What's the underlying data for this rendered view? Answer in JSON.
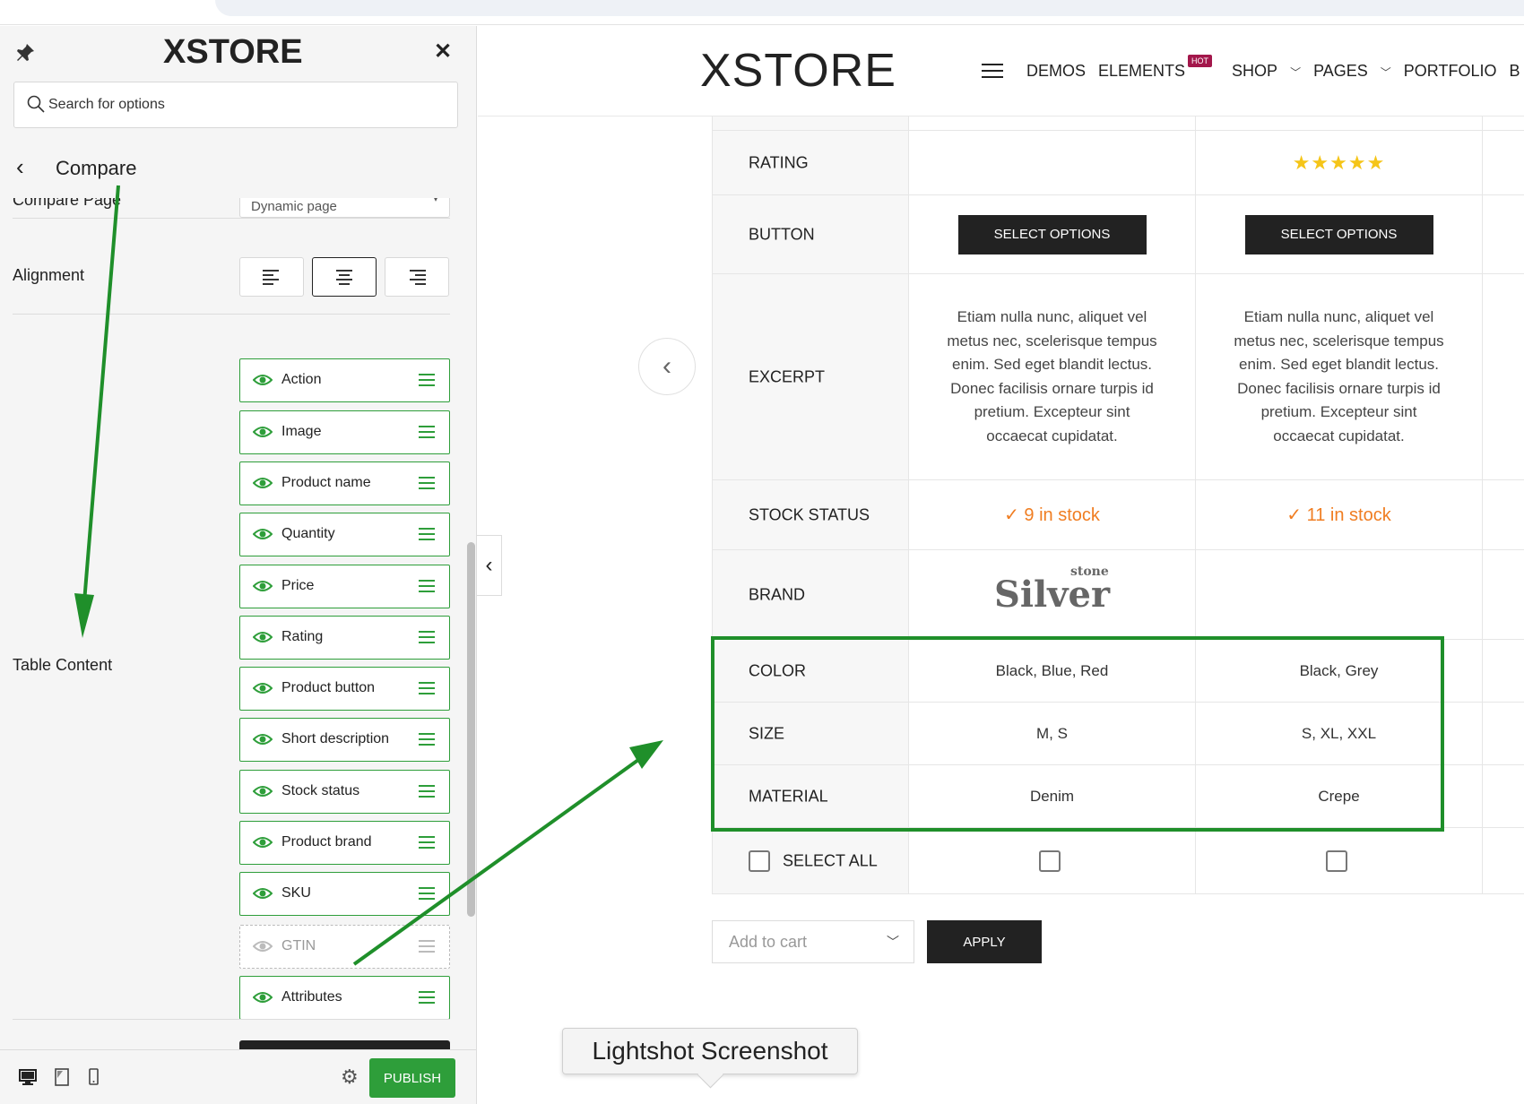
{
  "customizer": {
    "logo": "XSTORE",
    "search_placeholder": "Search for options",
    "section_title": "Compare",
    "compare_page_label": "Compare Page",
    "compare_page_value": "Dynamic page",
    "alignment_label": "Alignment",
    "table_content_label": "Table Content",
    "items": [
      {
        "label": "Action",
        "visible": true
      },
      {
        "label": "Image",
        "visible": true
      },
      {
        "label": "Product name",
        "visible": true
      },
      {
        "label": "Quantity",
        "visible": true
      },
      {
        "label": "Price",
        "visible": true
      },
      {
        "label": "Rating",
        "visible": true
      },
      {
        "label": "Product button",
        "visible": true
      },
      {
        "label": "Short description",
        "visible": true
      },
      {
        "label": "Stock status",
        "visible": true
      },
      {
        "label": "Product brand",
        "visible": true
      },
      {
        "label": "SKU",
        "visible": true
      },
      {
        "label": "GTIN",
        "visible": false
      },
      {
        "label": "Attributes",
        "visible": true
      }
    ],
    "publish_label": "PUBLISH"
  },
  "site": {
    "logo": "XSTORE",
    "nav": [
      "DEMOS",
      "ELEMENTS",
      "SHOP",
      "PAGES",
      "PORTFOLIO",
      "B"
    ],
    "hot_badge": "HOT"
  },
  "compare": {
    "rows": {
      "rating": "RATING",
      "button": "BUTTON",
      "excerpt": "EXCERPT",
      "stock_status": "STOCK STATUS",
      "brand": "BRAND",
      "color": "COLOR",
      "size": "SIZE",
      "material": "MATERIAL",
      "select_all": "SELECT ALL"
    },
    "products": [
      {
        "rating_stars": "",
        "button": "SELECT OPTIONS",
        "excerpt": "Etiam nulla nunc, aliquet vel metus nec, scelerisque tempus enim. Sed eget blandit lectus. Donec facilisis ornare turpis id pretium. Excepteur sint occaecat cupidatat.",
        "stock": "9 in stock",
        "brand_logo": "Silver",
        "brand_logo_small": "stone",
        "color": "Black, Blue, Red",
        "size": "M, S",
        "material": "Denim"
      },
      {
        "rating_stars": "★★★★★",
        "button": "SELECT OPTIONS",
        "excerpt": "Etiam nulla nunc, aliquet vel metus nec, scelerisque tempus enim. Sed eget blandit lectus. Donec facilisis ornare turpis id pretium. Excepteur sint occaecat cupidatat.",
        "stock": "11 in stock",
        "brand_logo": "",
        "brand_logo_small": "",
        "color": "Black, Grey",
        "size": "S, XL, XXL",
        "material": "Crepe"
      }
    ],
    "bulk_action_placeholder": "Add to cart",
    "apply_label": "APPLY"
  },
  "tooltip": "Lightshot Screenshot",
  "colors": {
    "accent_green": "#2e9e3a",
    "brand": "#a3174b",
    "stock": "#f07d21"
  }
}
